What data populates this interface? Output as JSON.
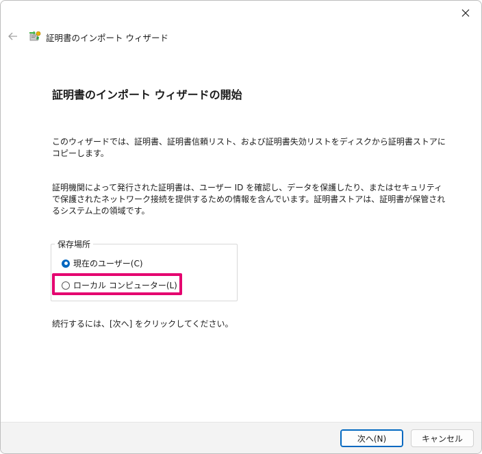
{
  "window": {
    "title": "証明書のインポート ウィザード",
    "close_icon": "close-icon",
    "back_icon": "back-arrow-icon",
    "wizard_icon": "certificate-wizard-icon"
  },
  "page": {
    "heading": "証明書のインポート ウィザードの開始",
    "paragraph1": "このウィザードでは、証明書、証明書信頼リスト、および証明書失効リストをディスクから証明書ストアにコピーします。",
    "paragraph2": "証明機関によって発行された証明書は、ユーザー ID を確認し、データを保護したり、またはセキュリティで保護されたネットワーク接続を提供するための情報を含んでいます。証明書ストアは、証明書が保管されるシステム上の領域です。",
    "instruction": "続行するには、[次へ] をクリックしてください。"
  },
  "location": {
    "legend": "保存場所",
    "options": [
      {
        "label": "現在のユーザー(C)",
        "selected": true
      },
      {
        "label": "ローカル コンピューター(L)",
        "selected": false
      }
    ]
  },
  "buttons": {
    "next": "次へ(N)",
    "cancel": "キャンセル"
  },
  "colors": {
    "accent": "#0067c0",
    "highlight": "#e4006f"
  }
}
